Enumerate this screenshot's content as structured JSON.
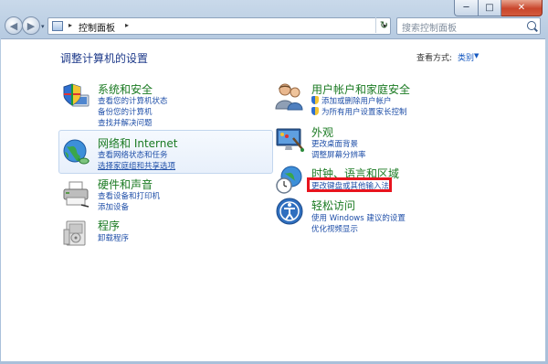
{
  "window": {
    "caption": {
      "minimize": "─",
      "maximize": "□",
      "close": "✕"
    }
  },
  "nav": {
    "back_glyph": "◀",
    "forward_glyph": "▶",
    "address": {
      "sep1": "▸",
      "location": "控制面板",
      "sep2": "▸",
      "dropdown": "▾"
    },
    "refresh_glyph": "↻",
    "search_placeholder": "搜索控制面板"
  },
  "header": {
    "title": "调整计算机的设置",
    "view_by_label": "查看方式:",
    "view_by_value": "类别",
    "view_by_arrow": "▼"
  },
  "categories_left": [
    {
      "title": "系统和安全",
      "icon": "shield-computer-icon",
      "links": [
        "查看您的计算机状态",
        "备份您的计算机",
        "查找并解决问题"
      ]
    },
    {
      "title": "网络和 Internet",
      "icon": "network-globe-icon",
      "links": [
        "查看网络状态和任务",
        "选择家庭组和共享选项"
      ]
    },
    {
      "title": "硬件和声音",
      "icon": "printer-icon",
      "links": [
        "查看设备和打印机",
        "添加设备"
      ]
    },
    {
      "title": "程序",
      "icon": "programs-icon",
      "links": [
        "卸载程序"
      ]
    }
  ],
  "categories_right": [
    {
      "title": "用户帐户和家庭安全",
      "icon": "users-icon",
      "links": [
        "添加或删除用户帐户",
        "为所有用户设置家长控制"
      ]
    },
    {
      "title": "外观",
      "icon": "appearance-icon",
      "links": [
        "更改桌面背景",
        "调整屏幕分辨率"
      ]
    },
    {
      "title": "时钟、语言和区域",
      "icon": "clock-globe-icon",
      "links": [
        "更改键盘或其他输入法"
      ]
    },
    {
      "title": "轻松访问",
      "icon": "ease-of-access-icon",
      "links": [
        "使用 Windows 建议的设置",
        "优化视频显示"
      ]
    }
  ],
  "colors": {
    "category_title": "#1a7a22",
    "link": "#1f4fa8",
    "highlight_box": "#e8141e"
  }
}
